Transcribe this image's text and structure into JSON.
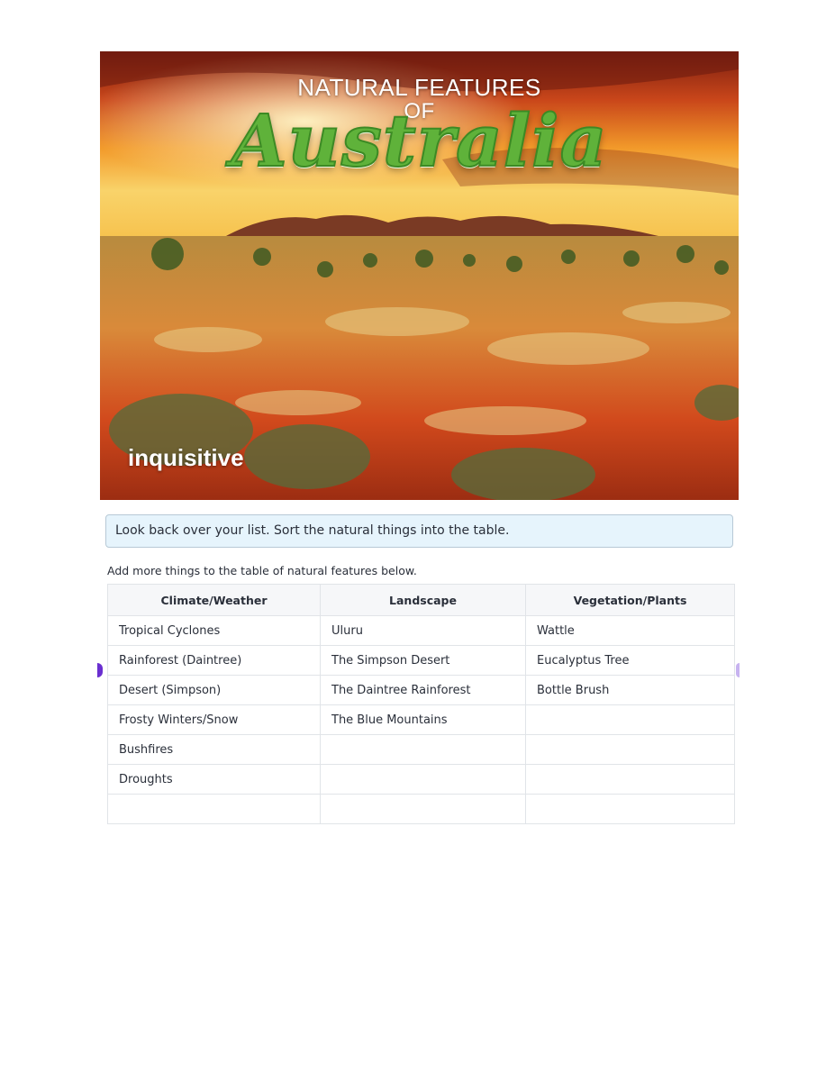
{
  "banner": {
    "title_line1": "NATURAL FEATURES",
    "title_line2": "OF",
    "title_main": "Australia",
    "brand": "inquisitive"
  },
  "instruction": "Look back over your list. Sort the natural things into the table.",
  "subtitle": "Add more things to the table of natural features below.",
  "table": {
    "headers": [
      "Climate/Weather",
      "Landscape",
      "Vegetation/Plants"
    ],
    "rows": [
      [
        "Tropical Cyclones",
        "Uluru",
        "Wattle"
      ],
      [
        "Rainforest (Daintree)",
        "The Simpson Desert",
        "Eucalyptus Tree"
      ],
      [
        "Desert (Simpson)",
        "The Daintree Rainforest",
        "Bottle Brush"
      ],
      [
        "Frosty Winters/Snow",
        "The Blue Mountains",
        ""
      ],
      [
        "Bushfires",
        "",
        ""
      ],
      [
        "Droughts",
        "",
        ""
      ],
      [
        "",
        "",
        ""
      ]
    ]
  },
  "colors": {
    "title_green": "#5fb23a",
    "instruction_bg": "#e6f4fc",
    "header_bg": "#f6f7f9"
  }
}
